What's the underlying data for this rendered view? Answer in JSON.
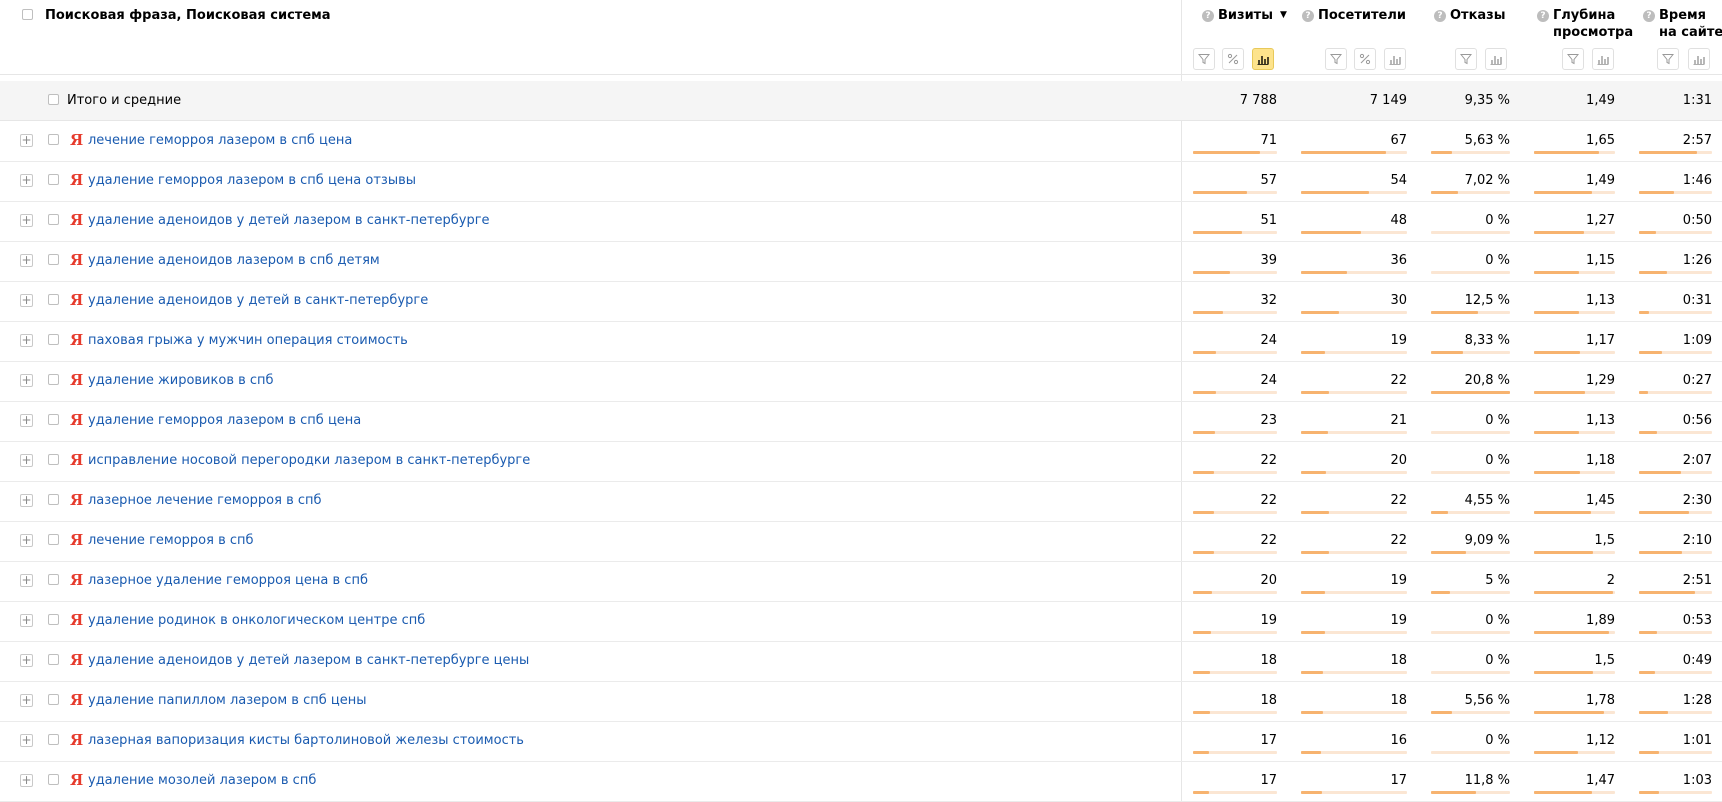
{
  "header": {
    "dimension_title": "Поисковая фраза, Поисковая система",
    "metrics": [
      {
        "key": "visits",
        "title_lines": [
          "Визиты"
        ],
        "sorted": true,
        "sort_arrow": "▼",
        "icons": [
          "filter-icon",
          "percent-icon",
          "bar-chart-icon"
        ],
        "active_icon": "bar-chart-icon"
      },
      {
        "key": "visitors",
        "title_lines": [
          "Посетители"
        ],
        "sorted": false,
        "icons": [
          "filter-icon",
          "percent-icon",
          "bar-chart-icon"
        ]
      },
      {
        "key": "bounces",
        "title_lines": [
          "Отказы"
        ],
        "sorted": false,
        "icons": [
          "filter-icon",
          "bar-chart-icon"
        ]
      },
      {
        "key": "depth",
        "title_lines": [
          "Глубина",
          "просмотра"
        ],
        "sorted": false,
        "icons": [
          "filter-icon",
          "bar-chart-icon"
        ]
      },
      {
        "key": "time",
        "title_lines": [
          "Время",
          "на сайте"
        ],
        "sorted": false,
        "icons": [
          "filter-icon",
          "bar-chart-icon"
        ]
      }
    ],
    "help_glyph": "?"
  },
  "totals": {
    "label": "Итого и средние",
    "visits": "7 788",
    "visitors": "7 149",
    "bounces": "9,35 %",
    "depth": "1,49",
    "time": "1:31"
  },
  "search_engine_icon": "yandex-logo-icon",
  "search_engine_glyph": "Я",
  "expand_glyph": "+",
  "colors": {
    "link": "#1a5bb0",
    "bar": "#f7b36f",
    "bar_bg": "#fbe6d3",
    "yandex": "#e63a2b",
    "active_icon": "#fde38c"
  },
  "rows": [
    {
      "phrase": "лечение геморроя лазером в спб цена",
      "visits": "71",
      "visitors": "67",
      "bounces": "5,63 %",
      "depth": "1,65",
      "time": "2:57",
      "bars": {
        "visits": 0.8,
        "visitors": 0.8,
        "bounces": 0.27,
        "depth": 0.8,
        "time": 0.8
      }
    },
    {
      "phrase": "удаление геморроя лазером в спб цена отзывы",
      "visits": "57",
      "visitors": "54",
      "bounces": "7,02 %",
      "depth": "1,49",
      "time": "1:46",
      "bars": {
        "visits": 0.64,
        "visitors": 0.64,
        "bounces": 0.34,
        "depth": 0.72,
        "time": 0.48
      }
    },
    {
      "phrase": "удаление аденоидов у детей лазером в санкт-петербурге",
      "visits": "51",
      "visitors": "48",
      "bounces": "0 %",
      "depth": "1,27",
      "time": "0:50",
      "bars": {
        "visits": 0.58,
        "visitors": 0.57,
        "bounces": 0,
        "depth": 0.62,
        "time": 0.23
      }
    },
    {
      "phrase": "удаление аденоидов лазером в спб детям",
      "visits": "39",
      "visitors": "36",
      "bounces": "0 %",
      "depth": "1,15",
      "time": "1:26",
      "bars": {
        "visits": 0.44,
        "visitors": 0.43,
        "bounces": 0,
        "depth": 0.56,
        "time": 0.39
      }
    },
    {
      "phrase": "удаление аденоидов у детей в санкт-петербурге",
      "visits": "32",
      "visitors": "30",
      "bounces": "12,5 %",
      "depth": "1,13",
      "time": "0:31",
      "bars": {
        "visits": 0.36,
        "visitors": 0.36,
        "bounces": 0.6,
        "depth": 0.55,
        "time": 0.14
      }
    },
    {
      "phrase": "паховая грыжа у мужчин операция стоимость",
      "visits": "24",
      "visitors": "19",
      "bounces": "8,33 %",
      "depth": "1,17",
      "time": "1:09",
      "bars": {
        "visits": 0.27,
        "visitors": 0.23,
        "bounces": 0.4,
        "depth": 0.57,
        "time": 0.31
      }
    },
    {
      "phrase": "удаление жировиков в спб",
      "visits": "24",
      "visitors": "22",
      "bounces": "20,8 %",
      "depth": "1,29",
      "time": "0:27",
      "bars": {
        "visits": 0.27,
        "visitors": 0.26,
        "bounces": 1,
        "depth": 0.63,
        "time": 0.12
      }
    },
    {
      "phrase": "удаление геморроя лазером в спб цена",
      "visits": "23",
      "visitors": "21",
      "bounces": "0 %",
      "depth": "1,13",
      "time": "0:56",
      "bars": {
        "visits": 0.26,
        "visitors": 0.25,
        "bounces": 0,
        "depth": 0.55,
        "time": 0.25
      }
    },
    {
      "phrase": "исправление носовой перегородки лазером в санкт-петербурге",
      "visits": "22",
      "visitors": "20",
      "bounces": "0 %",
      "depth": "1,18",
      "time": "2:07",
      "bars": {
        "visits": 0.25,
        "visitors": 0.24,
        "bounces": 0,
        "depth": 0.57,
        "time": 0.57
      }
    },
    {
      "phrase": "лазерное лечение геморроя в спб",
      "visits": "22",
      "visitors": "22",
      "bounces": "4,55 %",
      "depth": "1,45",
      "time": "2:30",
      "bars": {
        "visits": 0.25,
        "visitors": 0.26,
        "bounces": 0.22,
        "depth": 0.7,
        "time": 0.68
      }
    },
    {
      "phrase": "лечение геморроя в спб",
      "visits": "22",
      "visitors": "22",
      "bounces": "9,09 %",
      "depth": "1,5",
      "time": "2:10",
      "bars": {
        "visits": 0.25,
        "visitors": 0.26,
        "bounces": 0.44,
        "depth": 0.73,
        "time": 0.59
      }
    },
    {
      "phrase": "лазерное удаление геморроя цена в спб",
      "visits": "20",
      "visitors": "19",
      "bounces": "5 %",
      "depth": "2",
      "time": "2:51",
      "bars": {
        "visits": 0.23,
        "visitors": 0.23,
        "bounces": 0.24,
        "depth": 0.97,
        "time": 0.77
      }
    },
    {
      "phrase": "удаление родинок в онкологическом центре спб",
      "visits": "19",
      "visitors": "19",
      "bounces": "0 %",
      "depth": "1,89",
      "time": "0:53",
      "bars": {
        "visits": 0.21,
        "visitors": 0.23,
        "bounces": 0,
        "depth": 0.92,
        "time": 0.24
      }
    },
    {
      "phrase": "удаление аденоидов у детей лазером в санкт-петербурге цены",
      "visits": "18",
      "visitors": "18",
      "bounces": "0 %",
      "depth": "1,5",
      "time": "0:49",
      "bars": {
        "visits": 0.2,
        "visitors": 0.21,
        "bounces": 0,
        "depth": 0.73,
        "time": 0.22
      }
    },
    {
      "phrase": "удаление папиллом лазером в спб цены",
      "visits": "18",
      "visitors": "18",
      "bounces": "5,56 %",
      "depth": "1,78",
      "time": "1:28",
      "bars": {
        "visits": 0.2,
        "visitors": 0.21,
        "bounces": 0.27,
        "depth": 0.86,
        "time": 0.4
      }
    },
    {
      "phrase": "лазерная вапоризация кисты бартолиновой железы стоимость",
      "visits": "17",
      "visitors": "16",
      "bounces": "0 %",
      "depth": "1,12",
      "time": "1:01",
      "bars": {
        "visits": 0.19,
        "visitors": 0.19,
        "bounces": 0,
        "depth": 0.54,
        "time": 0.27
      }
    },
    {
      "phrase": "удаление мозолей лазером в спб",
      "visits": "17",
      "visitors": "17",
      "bounces": "11,8 %",
      "depth": "1,47",
      "time": "1:03",
      "bars": {
        "visits": 0.19,
        "visitors": 0.2,
        "bounces": 0.57,
        "depth": 0.71,
        "time": 0.28
      }
    }
  ]
}
